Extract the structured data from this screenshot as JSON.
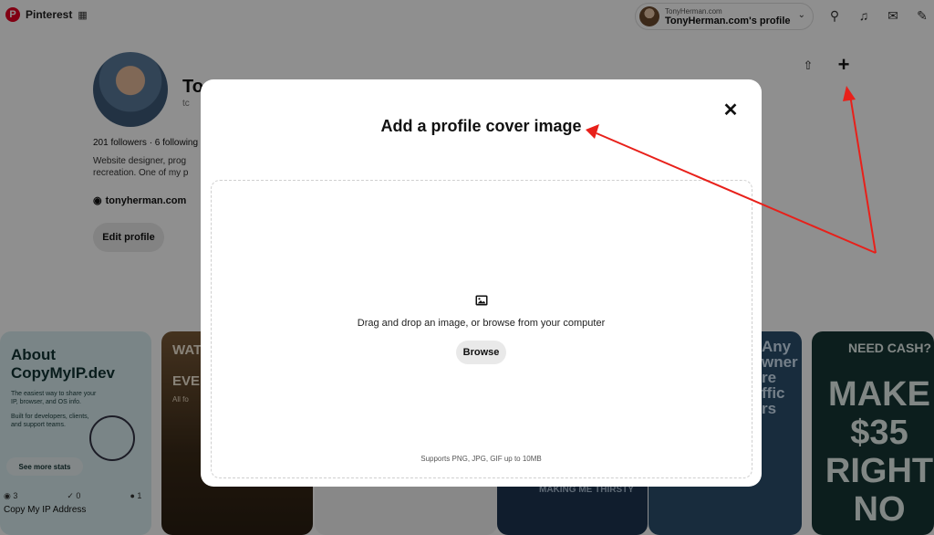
{
  "header": {
    "brand": "Pinterest",
    "account_small": "TonyHerman.com",
    "account_name": "TonyHerman.com's profile"
  },
  "profile": {
    "name_visible": "To",
    "username_visible": "tc",
    "stats": "201 followers · 6 following",
    "bio_line1": "Website designer, prog",
    "bio_line2": "recreation. One of my p",
    "website": "tonyherman.com",
    "edit_label": "Edit profile"
  },
  "pins": {
    "pin1_title_line1": "About",
    "pin1_title_line2": "CopyMyIP.dev",
    "pin1_sub": "The easiest way to share your IP, browser, and OS info.",
    "pin1_sub2": "Built for developers, clients, and support teams.",
    "pin1_button": "See more stats",
    "pin1_caption": "Copy My IP Address",
    "pin1_stat_views": "3",
    "pin1_stat_saves": "0",
    "pin1_stat_clicks": "1",
    "pin2_title": "WAT",
    "pin2_title2": "EVE",
    "pin2_small": "All fo",
    "pin4_text": "MAKING ME THIRSTY",
    "pin5_title": "Any wner re ffic rs",
    "pin6_title": "NEED CASH?",
    "pin6_big": "MAKE $35 RIGHT NO"
  },
  "modal": {
    "title": "Add a profile cover image",
    "drop_text": "Drag and drop an image, or browse from your computer",
    "browse_label": "Browse",
    "support_text": "Supports PNG, JPG, GIF up to 10MB"
  },
  "colors": {
    "brand_red": "#e60023",
    "annotation_red": "#e8201a",
    "button_gray": "#e9e9e9"
  },
  "icons": {
    "close": "close-icon",
    "image": "image-icon",
    "share": "share-icon",
    "plus": "plus-icon"
  }
}
